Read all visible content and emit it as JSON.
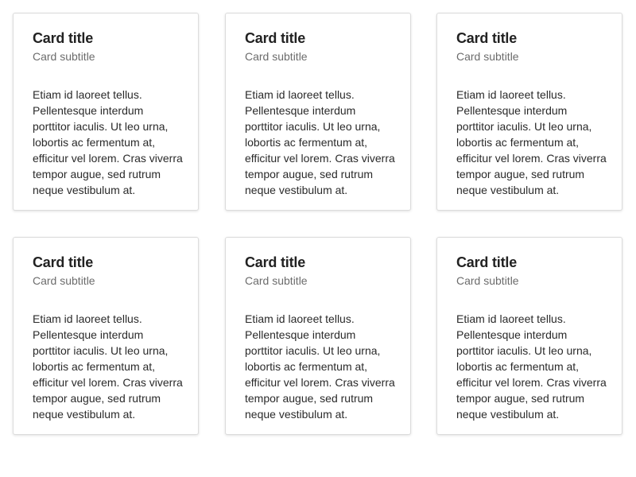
{
  "cards": [
    {
      "title": "Card title",
      "subtitle": "Card subtitle",
      "body": "Etiam id laoreet tellus. Pellentesque interdum porttitor iaculis. Ut leo urna, lobortis ac fermentum at, efficitur vel lorem. Cras viverra tempor augue, sed rutrum neque vestibulum at."
    },
    {
      "title": "Card title",
      "subtitle": "Card subtitle",
      "body": "Etiam id laoreet tellus. Pellentesque interdum porttitor iaculis. Ut leo urna, lobortis ac fermentum at, efficitur vel lorem. Cras viverra tempor augue, sed rutrum neque vestibulum at."
    },
    {
      "title": "Card title",
      "subtitle": "Card subtitle",
      "body": "Etiam id laoreet tellus. Pellentesque interdum porttitor iaculis. Ut leo urna, lobortis ac fermentum at, efficitur vel lorem. Cras viverra tempor augue, sed rutrum neque vestibulum at."
    },
    {
      "title": "Card title",
      "subtitle": "Card subtitle",
      "body": "Etiam id laoreet tellus. Pellentesque interdum porttitor iaculis. Ut leo urna, lobortis ac fermentum at, efficitur vel lorem. Cras viverra tempor augue, sed rutrum neque vestibulum at."
    },
    {
      "title": "Card title",
      "subtitle": "Card subtitle",
      "body": "Etiam id laoreet tellus. Pellentesque interdum porttitor iaculis. Ut leo urna, lobortis ac fermentum at, efficitur vel lorem. Cras viverra tempor augue, sed rutrum neque vestibulum at."
    },
    {
      "title": "Card title",
      "subtitle": "Card subtitle",
      "body": "Etiam id laoreet tellus. Pellentesque interdum porttitor iaculis. Ut leo urna, lobortis ac fermentum at, efficitur vel lorem. Cras viverra tempor augue, sed rutrum neque vestibulum at."
    }
  ]
}
